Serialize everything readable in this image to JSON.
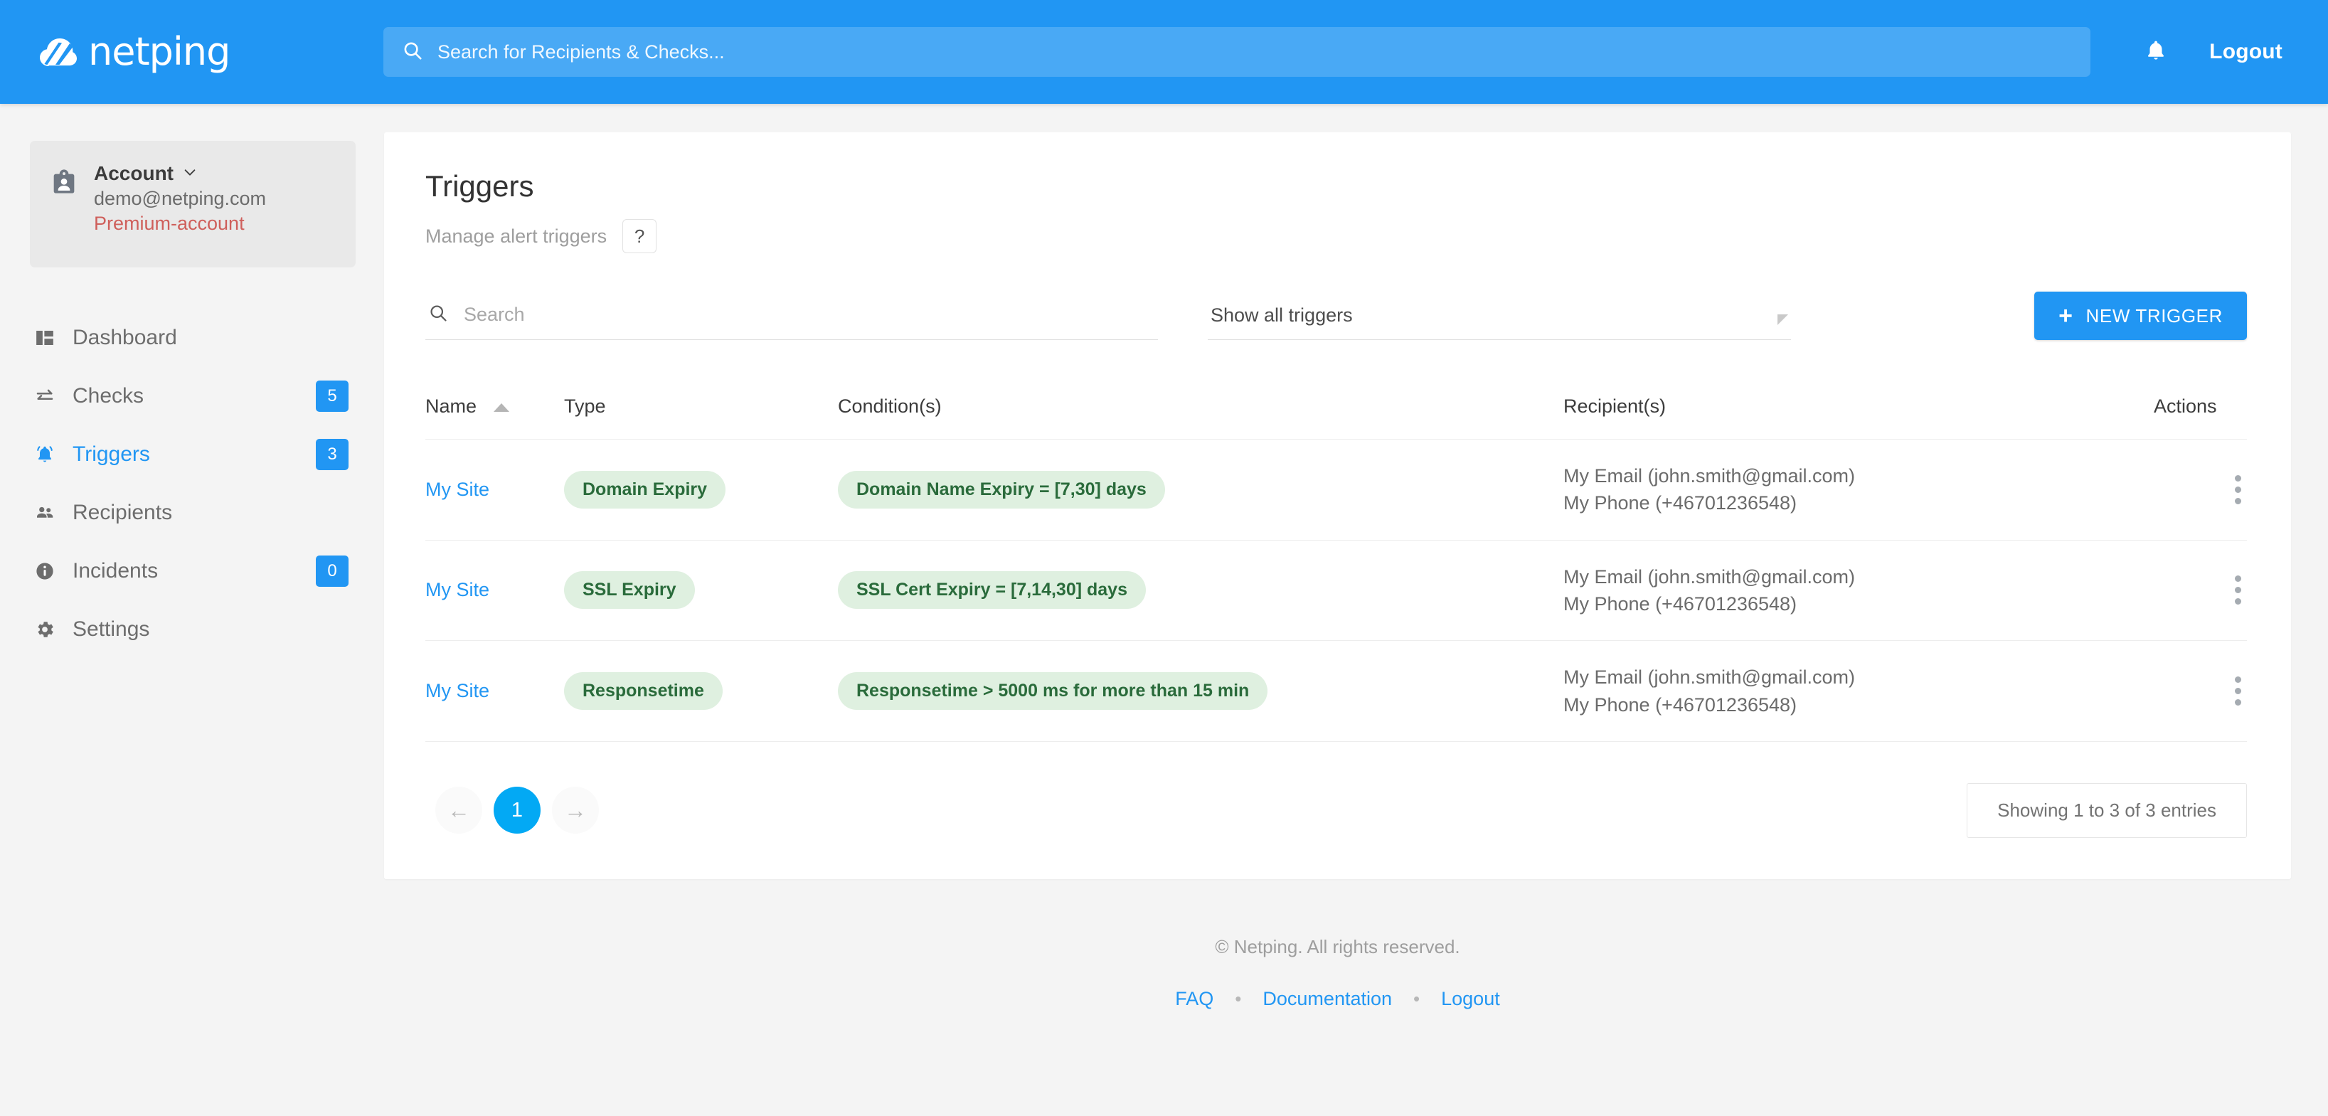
{
  "brand": {
    "name": "netping",
    "accent": "#2196f3",
    "logo_icon": "cloud-swoosh-icon"
  },
  "header": {
    "search": {
      "placeholder": "Search for Recipients & Checks...",
      "value": "",
      "icon": "search-icon"
    },
    "notifications_icon": "bell-icon",
    "logout_label": "Logout"
  },
  "sidebar": {
    "account": {
      "title": "Account",
      "chevron": "chevron-down-icon",
      "email": "demo@netping.com",
      "plan": "Premium-account",
      "plan_color": "#cf5f5b",
      "avatar_icon": "contact-card-icon"
    },
    "items": [
      {
        "label": "Dashboard",
        "icon": "dashboard-icon",
        "badge": null,
        "active": false
      },
      {
        "label": "Checks",
        "icon": "swap-arrows-icon",
        "badge": "5",
        "active": false
      },
      {
        "label": "Triggers",
        "icon": "bell-ring-icon",
        "badge": "3",
        "active": true
      },
      {
        "label": "Recipients",
        "icon": "people-icon",
        "badge": null,
        "active": false
      },
      {
        "label": "Incidents",
        "icon": "info-circle-icon",
        "badge": "0",
        "active": false
      },
      {
        "label": "Settings",
        "icon": "gear-icon",
        "badge": null,
        "active": false
      }
    ]
  },
  "main": {
    "title": "Triggers",
    "subtitle": "Manage alert triggers",
    "help_label": "?",
    "search": {
      "placeholder": "Search",
      "value": "",
      "icon": "search-icon"
    },
    "filter_select": {
      "value": "Show all triggers",
      "icon": "dropdown-caret-icon"
    },
    "new_button": {
      "label": "NEW TRIGGER",
      "icon": "plus-icon"
    },
    "table": {
      "headers": {
        "name": "Name",
        "type": "Type",
        "conditions": "Condition(s)",
        "recipients": "Recipient(s)",
        "actions": "Actions"
      },
      "sort": {
        "column": "Name",
        "direction": "asc",
        "icon": "sort-asc-icon"
      },
      "rows": [
        {
          "name": "My Site",
          "type": "Domain Expiry",
          "condition": "Domain Name Expiry = [7,30] days",
          "recipient_email": "My Email (john.smith@gmail.com)",
          "recipient_phone": "My Phone (+46701236548)",
          "actions_icon": "kebab-menu-icon"
        },
        {
          "name": "My Site",
          "type": "SSL Expiry",
          "condition": "SSL Cert Expiry = [7,14,30] days",
          "recipient_email": "My Email (john.smith@gmail.com)",
          "recipient_phone": "My Phone (+46701236548)",
          "actions_icon": "kebab-menu-icon"
        },
        {
          "name": "My Site",
          "type": "Responsetime",
          "condition": "Responsetime > 5000 ms for more than 15 min",
          "recipient_email": "My Email (john.smith@gmail.com)",
          "recipient_phone": "My Phone (+46701236548)",
          "actions_icon": "kebab-menu-icon"
        }
      ],
      "pill_bg": "#dff0e0",
      "pill_color": "#2a6b3b"
    },
    "pagination": {
      "prev_icon": "arrow-left-icon",
      "prev_label": "←",
      "current_page": "1",
      "next_icon": "arrow-right-icon",
      "next_label": "→",
      "entries_text": "Showing 1 to 3 of 3 entries"
    }
  },
  "footer": {
    "copyright": "© Netping. All rights reserved.",
    "links": [
      {
        "label": "FAQ"
      },
      {
        "label": "Documentation"
      },
      {
        "label": "Logout"
      }
    ],
    "separator": "•"
  }
}
